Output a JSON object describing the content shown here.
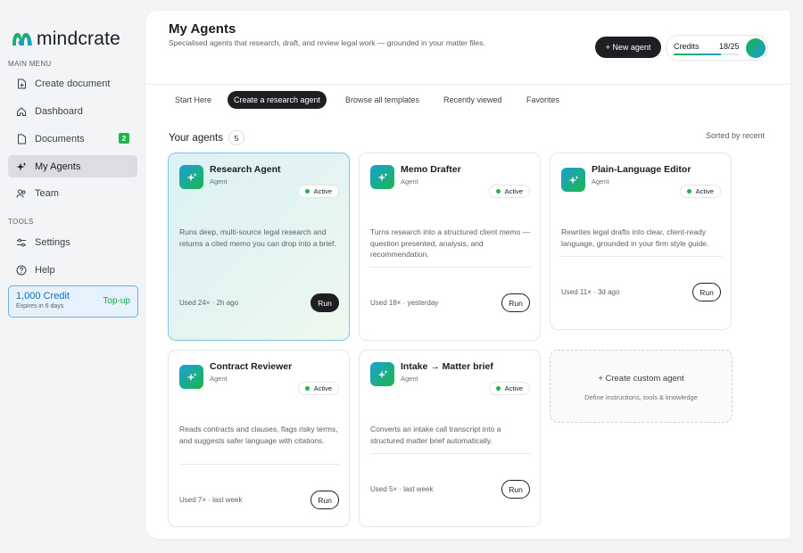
{
  "brand": {
    "name": "mindcrate",
    "logo_icon": "mindcrate-logo"
  },
  "sidebar": {
    "main_menu_label": "MAIN MENU",
    "items": [
      {
        "label": "Create document",
        "icon": "document-plus-icon"
      },
      {
        "label": "Dashboard",
        "icon": "home-icon"
      },
      {
        "label": "Documents",
        "icon": "file-icon",
        "badge": "2"
      },
      {
        "label": "My Agents",
        "icon": "sparkle-icon",
        "active": true
      },
      {
        "label": "Team",
        "icon": "team-icon"
      }
    ],
    "tools_label": "TOOLS",
    "tools": [
      {
        "label": "Settings",
        "icon": "sliders-icon"
      },
      {
        "label": "Help",
        "icon": "help-icon"
      }
    ],
    "credit": {
      "amount": "1,000 Credit",
      "expires": "Expires in 6 days",
      "action": "Top-up"
    }
  },
  "header": {
    "title": "My Agents",
    "subtitle": "Specialised agents that research, draft, and review legal work — grounded in your matter files.",
    "new_agent": "+ New agent",
    "credits": {
      "label": "Credits",
      "value": "18/25",
      "used_fraction": 0.72
    }
  },
  "tabs": [
    "Start Here",
    "Create a research agent",
    "Browse all templates",
    "Recently viewed",
    "Favorites"
  ],
  "active_tab": 1,
  "agents_section": {
    "title": "Your agents",
    "count": "5",
    "sort_label": "Sorted by recent"
  },
  "agents": [
    {
      "title": "Research Agent",
      "type": "Agent",
      "status": "Active",
      "description": "Runs deep, multi-source legal research and returns a cited memo you can drop into a brief.",
      "used": "Used 24× · 2h ago",
      "run": "Run"
    },
    {
      "title": "Memo Drafter",
      "type": "Agent",
      "status": "Active",
      "description": "Turns research into a structured client memo — question presented, analysis, and recommendation.",
      "used": "Used 18× · yesterday",
      "run": "Run"
    },
    {
      "title": "Plain-Language Editor",
      "type": "Agent",
      "status": "Active",
      "description": "Rewrites legal drafts into clear, client-ready language, grounded in your firm style guide.",
      "used": "Used 11× · 3d ago",
      "run": "Run"
    },
    {
      "title": "Contract Reviewer",
      "type": "Agent",
      "status": "Active",
      "description": "Reads contracts and clauses, flags risky terms, and suggests safer language with citations.",
      "used": "Used 7× · last week",
      "run": "Run"
    },
    {
      "title": "Intake → Matter brief",
      "type": "Agent",
      "status": "Active",
      "description": "Converts an intake call transcript into a structured matter brief automatically.",
      "used": "Used 5× · last week",
      "run": "Run"
    }
  ],
  "custom_agent": {
    "title": "+  Create custom agent",
    "subtitle": "Define instructions, tools & knowledge"
  },
  "colors": {
    "accent_green": "#1db54a",
    "accent_blue": "#1aa0d8",
    "dark": "#1d1f22"
  }
}
